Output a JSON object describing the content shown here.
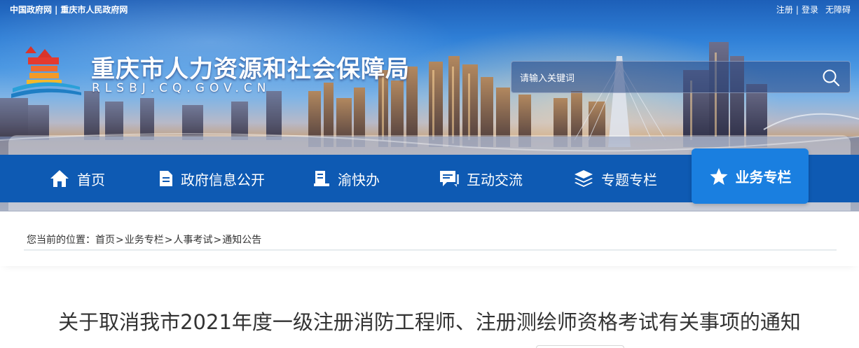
{
  "top_bar": {
    "left_links": [
      "中国政府网",
      "重庆市人民政府网"
    ],
    "separator": "|",
    "right_links": [
      "注册",
      "登录",
      "无障碍"
    ]
  },
  "header": {
    "site_title": "重庆市人力资源和社会保障局",
    "site_domain": "RLSBJ.CQ.GOV.CN"
  },
  "search": {
    "placeholder": "请输入关键词"
  },
  "nav": {
    "items": [
      {
        "label": "首页",
        "icon": "home-icon"
      },
      {
        "label": "政府信息公开",
        "icon": "document-icon"
      },
      {
        "label": "渝快办",
        "icon": "book-icon"
      },
      {
        "label": "互动交流",
        "icon": "chat-icon"
      },
      {
        "label": "专题专栏",
        "icon": "layers-icon"
      },
      {
        "label": "业务专栏",
        "icon": "star-icon",
        "active": true
      }
    ]
  },
  "breadcrumb": {
    "prefix": "您当前的位置：",
    "items": [
      "首页",
      "业务专栏",
      "人事考试",
      "通知公告"
    ],
    "separator": ">"
  },
  "article": {
    "title": "关于取消我市2021年度一级注册消防工程师、注册测绘师资格考试有关事项的通知"
  },
  "colors": {
    "nav_bg": "#0e5ab3",
    "nav_active_bg": "#1a7fe0",
    "title_text": "#333333"
  }
}
